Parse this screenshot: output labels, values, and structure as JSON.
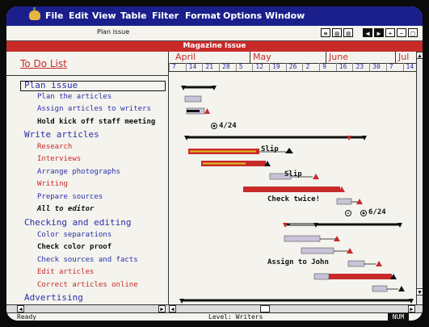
{
  "menu": {
    "items": [
      "File",
      "Edit",
      "View",
      "Table",
      "Filter",
      "Format",
      "Options",
      "Window"
    ]
  },
  "toolbar": {
    "document_name": "Plan issue",
    "buttons": [
      "left-arrow",
      "right-arrow",
      "plus",
      "minus",
      "box"
    ]
  },
  "window": {
    "title": "Magazine Issue"
  },
  "pane": {
    "header": "To Do List"
  },
  "tasks": [
    {
      "label": "Plan issue",
      "style": "grp"
    },
    {
      "label": "Plan the articles",
      "style": "blue"
    },
    {
      "label": "Assign articles to writers",
      "style": "blue"
    },
    {
      "label": "Hold kick off staff meeting",
      "style": "black"
    },
    {
      "label": "Write articles",
      "style": "grp"
    },
    {
      "label": "Research",
      "style": "red"
    },
    {
      "label": "Interviews",
      "style": "red"
    },
    {
      "label": "Arrange photographs",
      "style": "blue"
    },
    {
      "label": "Writing",
      "style": "red"
    },
    {
      "label": "Prepare sources",
      "style": "blue"
    },
    {
      "label": "All to editor",
      "style": "it"
    },
    {
      "label": "Checking and editing",
      "style": "grp"
    },
    {
      "label": "Color separations",
      "style": "blue"
    },
    {
      "label": "Check color proof",
      "style": "black"
    },
    {
      "label": "Check sources and facts",
      "style": "blue"
    },
    {
      "label": "Edit articles",
      "style": "red"
    },
    {
      "label": "Correct articles online",
      "style": "red"
    },
    {
      "label": "Advertising",
      "style": "grp"
    }
  ],
  "timeline": {
    "months": [
      "April",
      "May",
      "June",
      "Jul"
    ],
    "days": [
      "7",
      "14",
      "21",
      "28",
      "5",
      "12",
      "19",
      "26",
      "2",
      "9",
      "16",
      "23",
      "30",
      "7",
      "14"
    ]
  },
  "annotations": {
    "meeting_date": "4/24",
    "research_slip": "Slip",
    "photo_slip": "Slip",
    "check_twice": "Check twice!",
    "editor_date": "6/24",
    "assign_john": "Assign to John"
  },
  "status": {
    "left": "Ready",
    "center": "Level: Writers",
    "right": "NUM"
  },
  "colors": {
    "menubar": "#1a1f8c",
    "titlebar": "#c82a2a",
    "task_blue": "#2a2fa8",
    "task_red": "#c82a2a",
    "bar_red": "#c82a2a",
    "bar_gray": "#c8c3d8",
    "bar_yellow": "#e0c020"
  }
}
